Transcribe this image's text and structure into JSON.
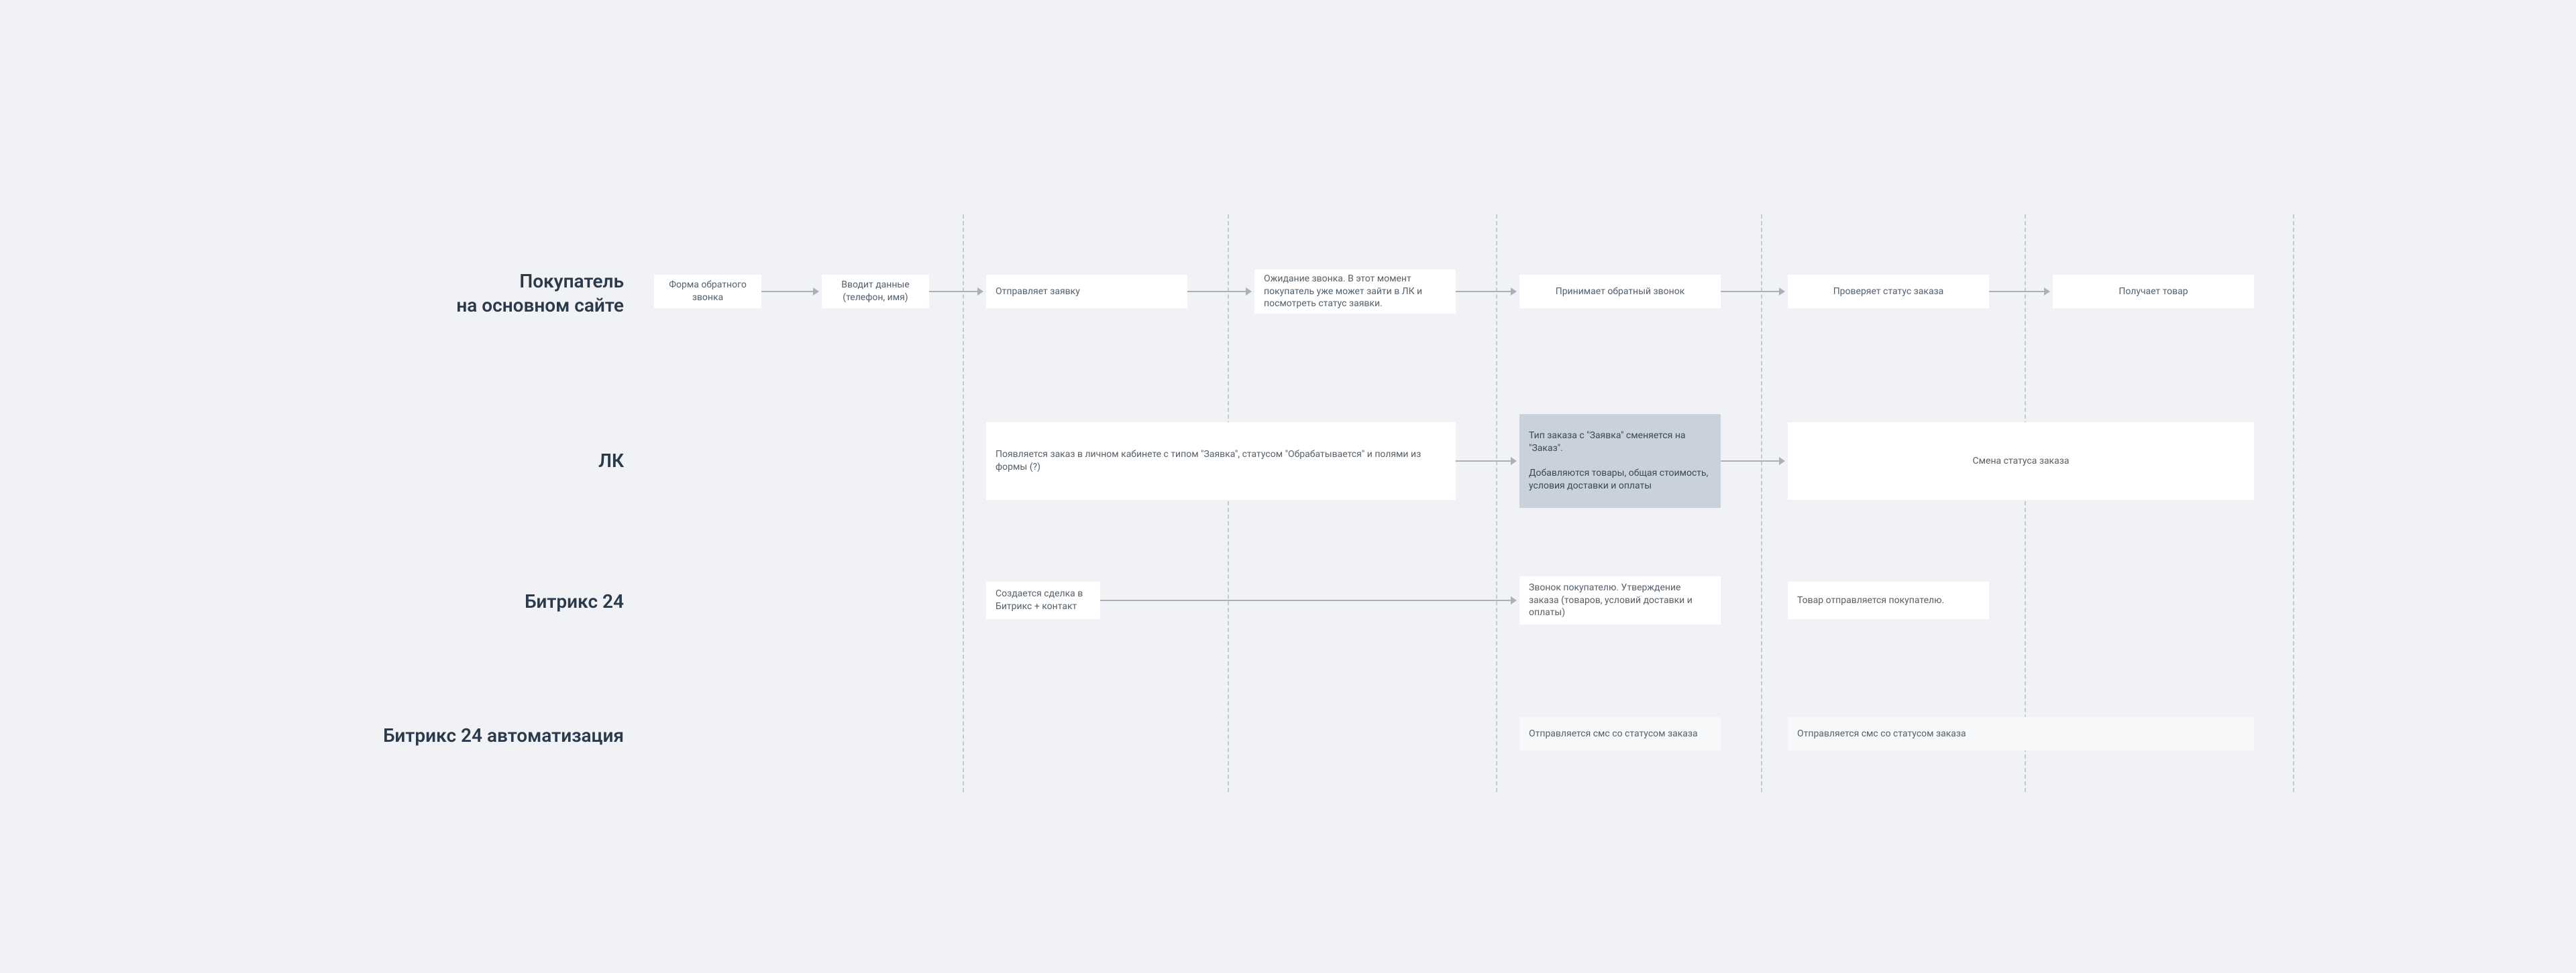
{
  "lanes": {
    "buyer": "Покупатель\nна основном сайте",
    "lk": "ЛК",
    "bitrix": "Битрикс 24",
    "bitrix_auto": "Битрикс 24 автоматизация"
  },
  "buyer_row": {
    "n0": "Форма обратного звонка",
    "n1": "Вводит данные (телефон, имя)",
    "n2": "Отправляет заявку",
    "n3": "Ожидание звонка. В этот момент покупатель уже может зайти в ЛК и посмотреть статус заявки.",
    "n4": "Принимает обратный звонок",
    "n5": "Проверяет статус заказа",
    "n6": "Получает товар"
  },
  "lk_row": {
    "n0": "Появляется заказ в личном кабинете с типом \"Заявка\", статусом \"Обрабатывается\" и полями из формы (?)",
    "n1": "Тип заказа с \"Заявка\" сменяется на \"Заказ\".\n\nДобавляются товары, общая стоимость, условия доставки и оплаты",
    "n2": "Смена статуса заказа"
  },
  "bitrix_row": {
    "n0": "Создается сделка в Битрикс + контакт",
    "n1": "Звонок покупателю. Утверждение заказа (товаров, условий доставки и оплаты)",
    "n2": "Товар отправляется покупателю."
  },
  "bitrix_auto_row": {
    "n0": "Отправляется смс со статусом заказа",
    "n1": "Отправляется смс со статусом заказа"
  }
}
